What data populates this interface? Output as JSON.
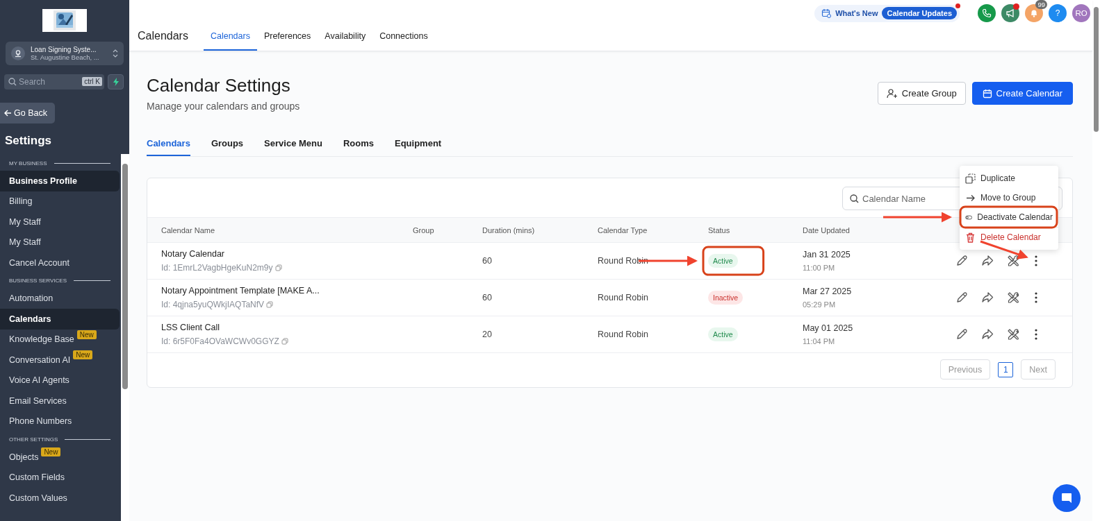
{
  "sidebar": {
    "account": {
      "name": "Loan Signing Syste...",
      "location": "St. Augustine Beach, ..."
    },
    "search": {
      "placeholder": "Search",
      "shortcut": "ctrl K"
    },
    "back_button": "Go Back",
    "title": "Settings",
    "sections": [
      {
        "title": "MY BUSINESS",
        "items": [
          {
            "label": "Business Profile",
            "selected": true
          },
          {
            "label": "Billing",
            "selected": false
          },
          {
            "label": "My Staff",
            "selected": false
          },
          {
            "label": "My Staff",
            "selected": false
          },
          {
            "label": "Cancel Account",
            "selected": false
          }
        ]
      },
      {
        "title": "BUSINESS SERVICES",
        "items": [
          {
            "label": "Automation",
            "selected": false
          },
          {
            "label": "Calendars",
            "selected": true
          },
          {
            "label": "Knowledge Base",
            "selected": false,
            "badge": "New"
          },
          {
            "label": "Conversation AI",
            "selected": false,
            "badge": "New"
          },
          {
            "label": "Voice AI Agents",
            "selected": false
          },
          {
            "label": "Email Services",
            "selected": false
          },
          {
            "label": "Phone Numbers",
            "selected": false
          }
        ]
      },
      {
        "title": "OTHER SETTINGS",
        "items": [
          {
            "label": "Objects",
            "selected": false,
            "badge": "New"
          },
          {
            "label": "Custom Fields",
            "selected": false
          },
          {
            "label": "Custom Values",
            "selected": false
          }
        ]
      }
    ]
  },
  "top_bar": {
    "whats_new": "What's New",
    "updates_badge": "Calendar Updates",
    "notification_count": "99",
    "help": "?",
    "avatar": "RO"
  },
  "header": {
    "title": "Calendars",
    "tabs": [
      {
        "label": "Calendars",
        "selected": true
      },
      {
        "label": "Preferences",
        "selected": false
      },
      {
        "label": "Availability",
        "selected": false
      },
      {
        "label": "Connections",
        "selected": false
      }
    ]
  },
  "page": {
    "title": "Calendar Settings",
    "subtitle": "Manage your calendars and groups",
    "buttons": [
      {
        "label": "Create Group",
        "kind": "secondary"
      },
      {
        "label": "Create Calendar",
        "kind": "primary"
      }
    ],
    "tabs": [
      {
        "label": "Calendars",
        "selected": true
      },
      {
        "label": "Groups",
        "selected": false
      },
      {
        "label": "Service Menu",
        "selected": false
      },
      {
        "label": "Rooms",
        "selected": false
      },
      {
        "label": "Equipment",
        "selected": false
      }
    ]
  },
  "table": {
    "search_placeholder": "Calendar Name",
    "columns": [
      "Calendar Name",
      "Group",
      "Duration (mins)",
      "Calendar Type",
      "Status",
      "Date Updated"
    ],
    "rows": [
      {
        "name": "Notary Calendar",
        "id": "Id: 1EmrL2VagbHgeKuN2m9y",
        "duration": "60",
        "type": "Round Robin",
        "status": "Active",
        "active": true,
        "date": "Jan 31 2025",
        "time": "11:00 PM"
      },
      {
        "name": "Notary Appointment Template [MAKE A...",
        "id": "Id: 4qjna5yuQWkjIAQTaNfV",
        "duration": "60",
        "type": "Round Robin",
        "status": "Inactive",
        "active": false,
        "date": "Mar 27 2025",
        "time": "05:29 PM"
      },
      {
        "name": "LSS Client Call",
        "id": "Id: 6r5F0Fa4OVaWCWv0GGYZ",
        "duration": "20",
        "type": "Round Robin",
        "status": "Active",
        "active": true,
        "date": "May 01 2025",
        "time": "11:04 PM"
      }
    ],
    "pagination": {
      "previous": "Previous",
      "pages": [
        {
          "label": "1",
          "selected": true
        }
      ],
      "next": "Next"
    }
  },
  "menu": [
    {
      "label": "Duplicate",
      "kind": "duplicate"
    },
    {
      "label": "Move to Group",
      "kind": "move"
    },
    {
      "label": "Deactivate Calendar",
      "kind": "deactivate"
    },
    {
      "label": "Delete Calendar",
      "kind": "delete"
    }
  ],
  "annotations": [
    {
      "kind": "arrow"
    },
    {
      "kind": "frame"
    },
    {
      "kind": "arrow"
    },
    {
      "kind": "frame"
    },
    {
      "kind": "arrow"
    }
  ]
}
